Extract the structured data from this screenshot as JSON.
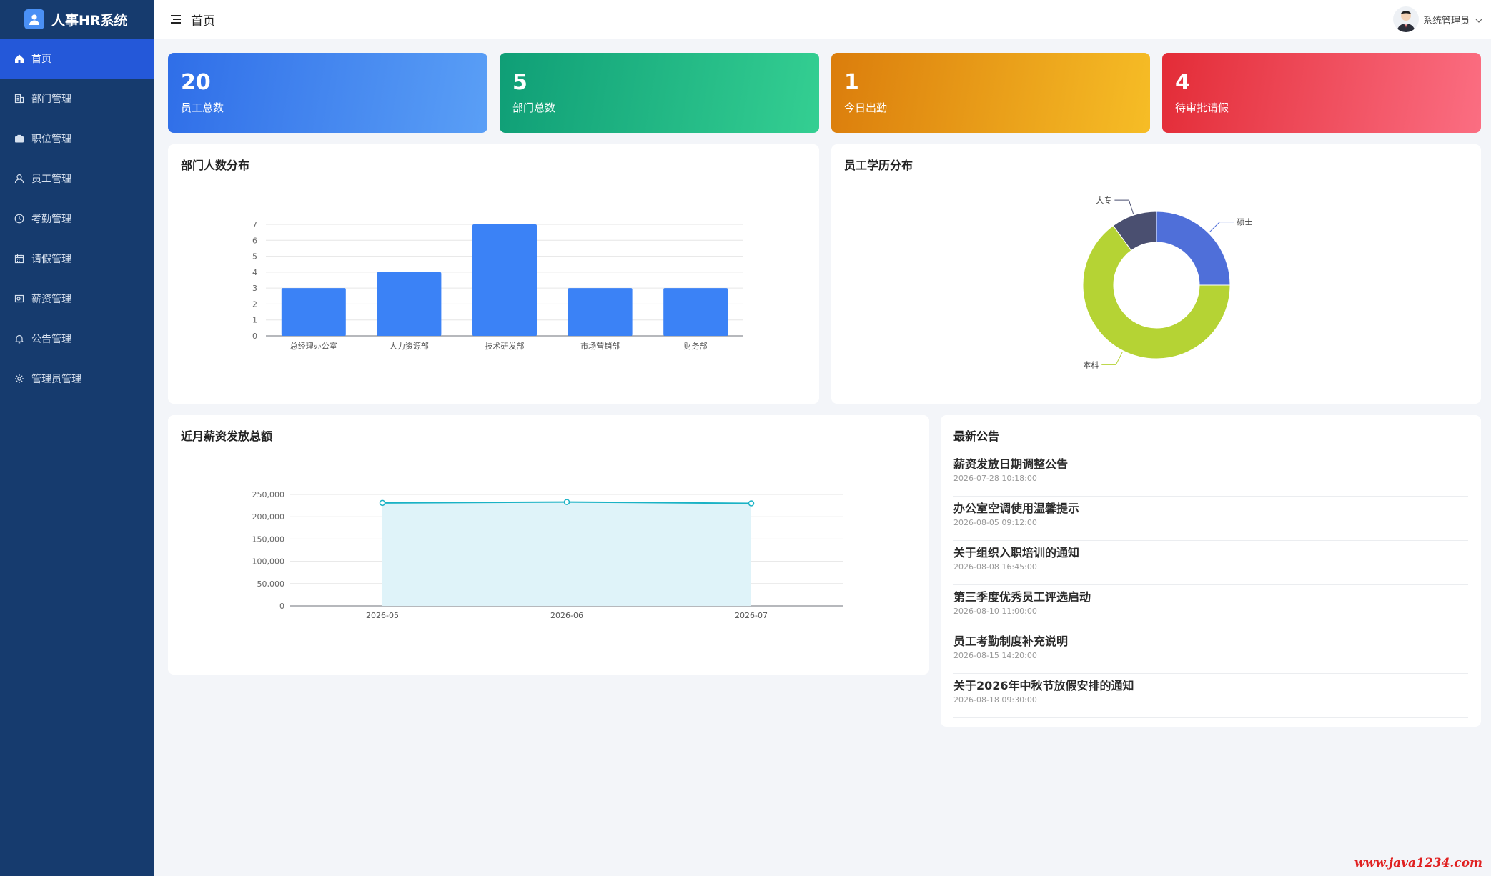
{
  "app": {
    "title": "人事HR系统"
  },
  "sidebar": {
    "items": [
      {
        "label": "首页",
        "icon": "home-icon"
      },
      {
        "label": "部门管理",
        "icon": "building-icon"
      },
      {
        "label": "职位管理",
        "icon": "briefcase-icon"
      },
      {
        "label": "员工管理",
        "icon": "user-icon"
      },
      {
        "label": "考勤管理",
        "icon": "clock-icon"
      },
      {
        "label": "请假管理",
        "icon": "calendar-icon"
      },
      {
        "label": "薪资管理",
        "icon": "money-icon"
      },
      {
        "label": "公告管理",
        "icon": "bell-icon"
      },
      {
        "label": "管理员管理",
        "icon": "gear-icon"
      }
    ],
    "active_index": 0
  },
  "header": {
    "page_title": "首页",
    "user_name": "系统管理员"
  },
  "stats": [
    {
      "value": "20",
      "label": "员工总数"
    },
    {
      "value": "5",
      "label": "部门总数"
    },
    {
      "value": "1",
      "label": "今日出勤"
    },
    {
      "value": "4",
      "label": "待审批请假"
    }
  ],
  "panels": {
    "dept_chart_title": "部门人数分布",
    "edu_chart_title": "员工学历分布",
    "salary_chart_title": "近月薪资发放总额",
    "notices_title": "最新公告"
  },
  "chart_data": [
    {
      "type": "bar",
      "title": "部门人数分布",
      "categories": [
        "总经理办公室",
        "人力资源部",
        "技术研发部",
        "市场营销部",
        "财务部"
      ],
      "values": [
        3,
        4,
        7,
        3,
        3
      ],
      "ylim": [
        0,
        7
      ],
      "yticks": [
        0,
        1,
        2,
        3,
        4,
        5,
        6,
        7
      ],
      "grid": true,
      "color": "#3b82f6"
    },
    {
      "type": "pie",
      "title": "员工学历分布",
      "labels": [
        "硕士",
        "本科",
        "大专"
      ],
      "values": [
        5,
        13,
        2
      ],
      "colors": [
        "#4f6fd9",
        "#b5d334",
        "#4a4f70"
      ]
    },
    {
      "type": "area",
      "title": "近月薪资发放总额",
      "x": [
        "2026-05",
        "2026-06",
        "2026-07"
      ],
      "values": [
        231000,
        233000,
        230000
      ],
      "ylim": [
        0,
        250000
      ],
      "yticks": [
        "0",
        "50,000",
        "100,000",
        "150,000",
        "200,000",
        "250,000"
      ],
      "grid": true,
      "color": "#1ab2c5"
    }
  ],
  "notices": [
    {
      "title": "薪资发放日期调整公告",
      "time": "2026-07-28 10:18:00"
    },
    {
      "title": "办公室空调使用温馨提示",
      "time": "2026-08-05 09:12:00"
    },
    {
      "title": "关于组织入职培训的通知",
      "time": "2026-08-08 16:45:00"
    },
    {
      "title": "第三季度优秀员工评选启动",
      "time": "2026-08-10 11:00:00"
    },
    {
      "title": "员工考勤制度补充说明",
      "time": "2026-08-15 14:20:00"
    },
    {
      "title": "关于2026年中秋节放假安排的通知",
      "time": "2026-08-18 09:30:00"
    }
  ],
  "watermark": "www.java1234.com"
}
